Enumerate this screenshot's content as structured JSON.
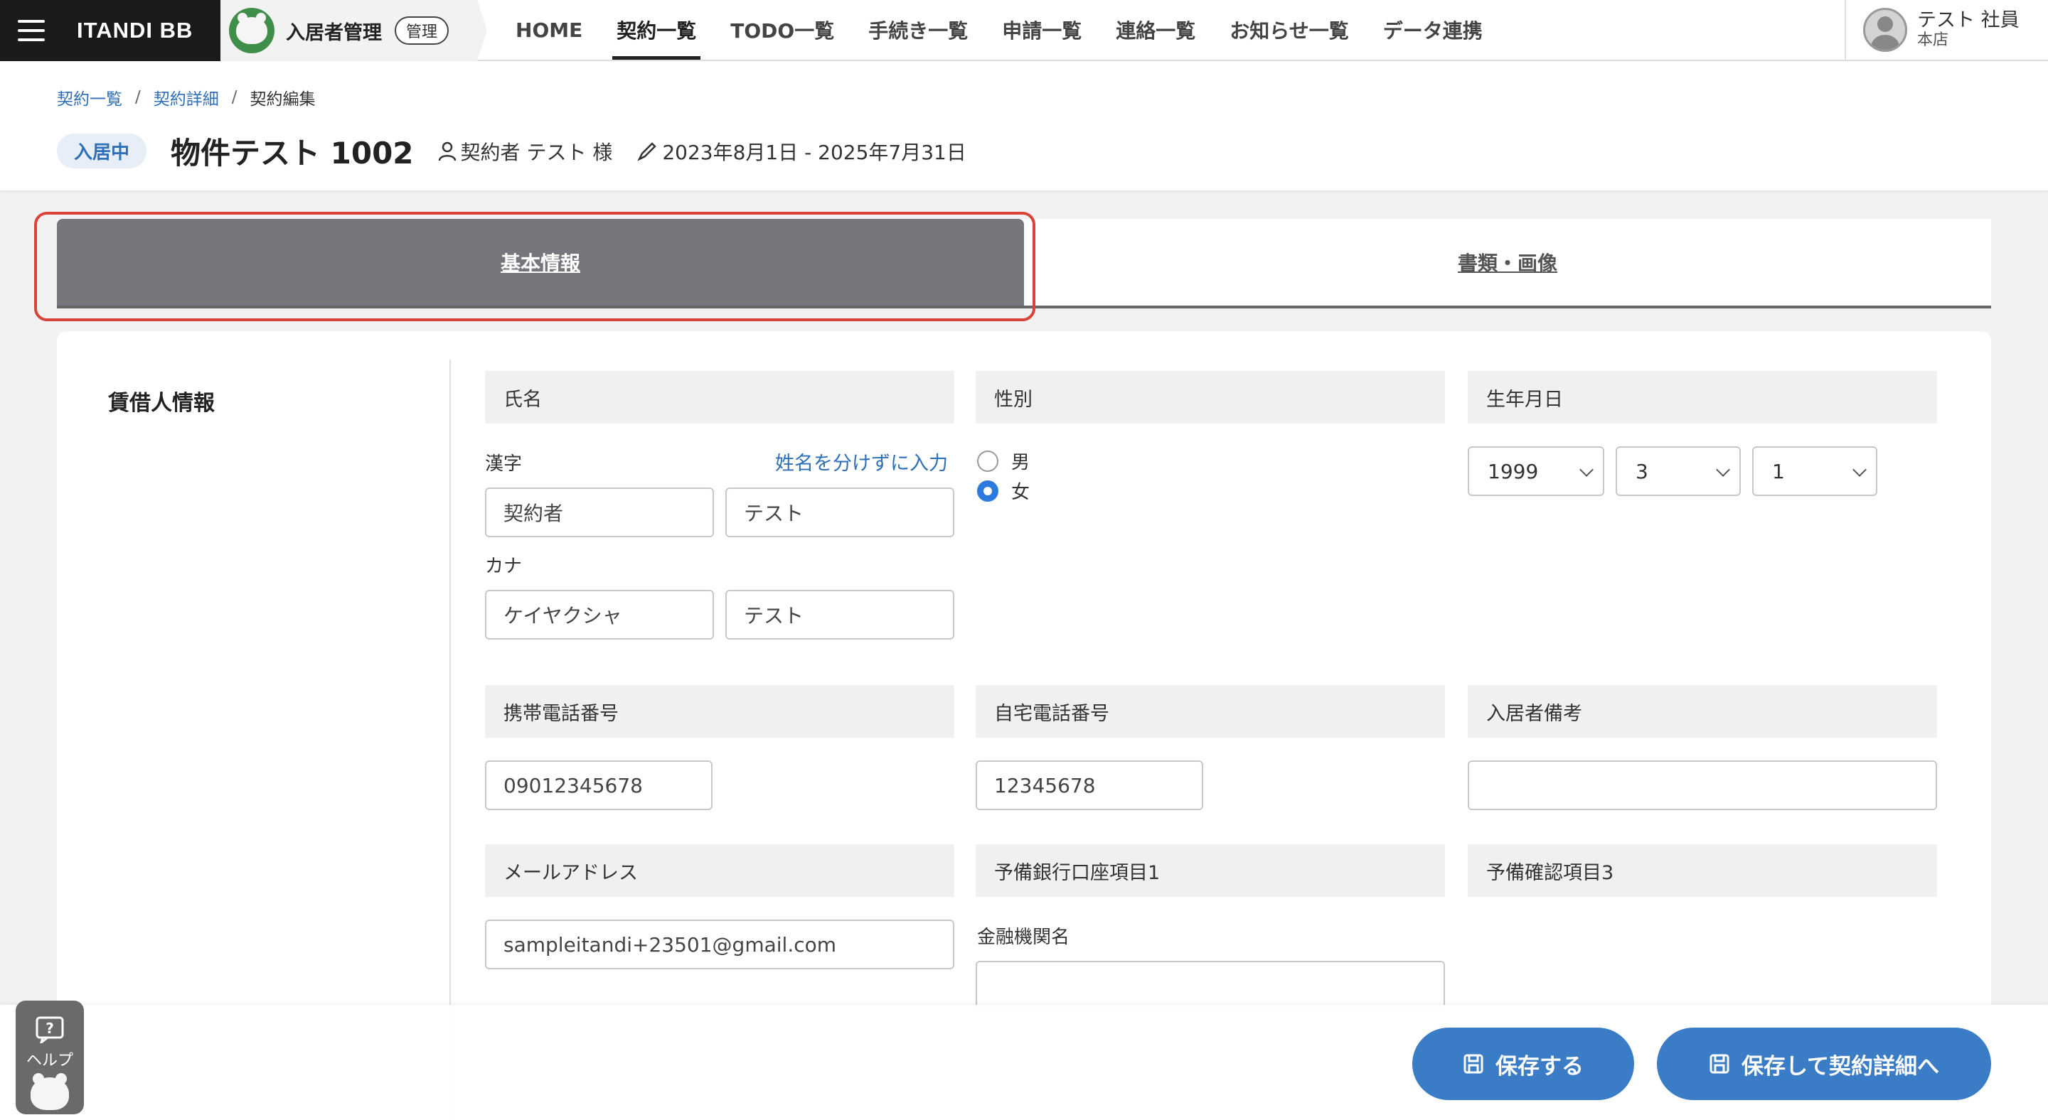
{
  "nav": {
    "brand": "ITANDI BB",
    "app_title": "入居者管理",
    "app_badge": "管理",
    "links": [
      "HOME",
      "契約一覧",
      "TODO一覧",
      "手続き一覧",
      "申請一覧",
      "連絡一覧",
      "お知らせ一覧",
      "データ連携"
    ],
    "active_link": "契約一覧",
    "user_name": "テスト 社員",
    "user_branch": "本店"
  },
  "breadcrumb": {
    "items": [
      "契約一覧",
      "契約詳細"
    ],
    "current": "契約編集",
    "separator": "/"
  },
  "header": {
    "status": "入居中",
    "property": "物件テスト 1002",
    "contractor": "契約者 テスト 様",
    "period": "2023年8月1日 - 2025年7月31日"
  },
  "tabs": {
    "basic": "基本情報",
    "docs": "書類・画像"
  },
  "form": {
    "section_title": "賃借人情報",
    "name": {
      "header": "氏名",
      "kanji_label": "漢字",
      "split_link": "姓名を分けずに入力",
      "kanji_last": "契約者",
      "kanji_first": "テスト",
      "kana_label": "カナ",
      "kana_last": "ケイヤクシャ",
      "kana_first": "テスト"
    },
    "gender": {
      "header": "性別",
      "options": [
        "男",
        "女"
      ],
      "selected": "女"
    },
    "birthdate": {
      "header": "生年月日",
      "year": "1999",
      "month": "3",
      "day": "1"
    },
    "mobile": {
      "header": "携帯電話番号",
      "value": "09012345678"
    },
    "home_phone": {
      "header": "自宅電話番号",
      "value": "12345678"
    },
    "notes": {
      "header": "入居者備考",
      "value": ""
    },
    "email": {
      "header": "メールアドレス",
      "value": "sampleitandi+23501@gmail.com"
    },
    "bank": {
      "header": "予備銀行口座項目1",
      "institution_label": "金融機関名",
      "institution_value": ""
    },
    "confirm3": {
      "header": "予備確認項目3"
    }
  },
  "buttons": {
    "save": "保存する",
    "save_and_detail": "保存して契約詳細へ"
  },
  "help": {
    "label": "ヘルプ"
  },
  "colors": {
    "accent": "#3a7cc5",
    "link": "#2e6fb7",
    "active_tab": "#77767c",
    "highlight": "#d9443a"
  }
}
